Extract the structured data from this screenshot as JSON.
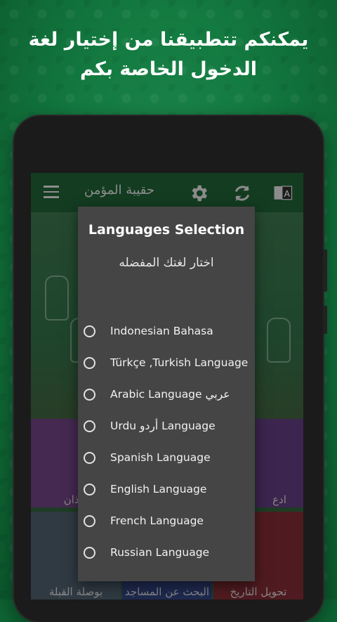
{
  "promo": {
    "line1": "يمكنكم تتطبيقنا من إختيار لغة",
    "line2": "الدخول الخاصة بكم"
  },
  "app": {
    "title": "حقيبة المؤمن",
    "icons": [
      "menu-icon",
      "gear-icon",
      "refresh-icon",
      "translate-icon"
    ]
  },
  "tiles": [
    {
      "label": "الاذان"
    },
    {
      "label": "ادع"
    },
    {
      "label": "بوصلة القبلة"
    },
    {
      "label": "البحث عن المساجد"
    },
    {
      "label": "تحويل التاريخ"
    }
  ],
  "dialog": {
    "title": "Languages Selection",
    "subtitle": "اختار لغتك المفضله",
    "options": [
      {
        "label": "Indonesian Bahasa"
      },
      {
        "label": "Türkçe ,Turkish Language"
      },
      {
        "label": "Arabic Language عربي"
      },
      {
        "label": "Urdu أردو Language"
      },
      {
        "label": "Spanish Language"
      },
      {
        "label": "English Language"
      },
      {
        "label": "French Language"
      },
      {
        "label": "Russian Language"
      }
    ]
  },
  "colors": {
    "background": "#137a40",
    "appbar": "#1e5d34",
    "dialog": "#454545",
    "radio": "#e2e2e2"
  }
}
